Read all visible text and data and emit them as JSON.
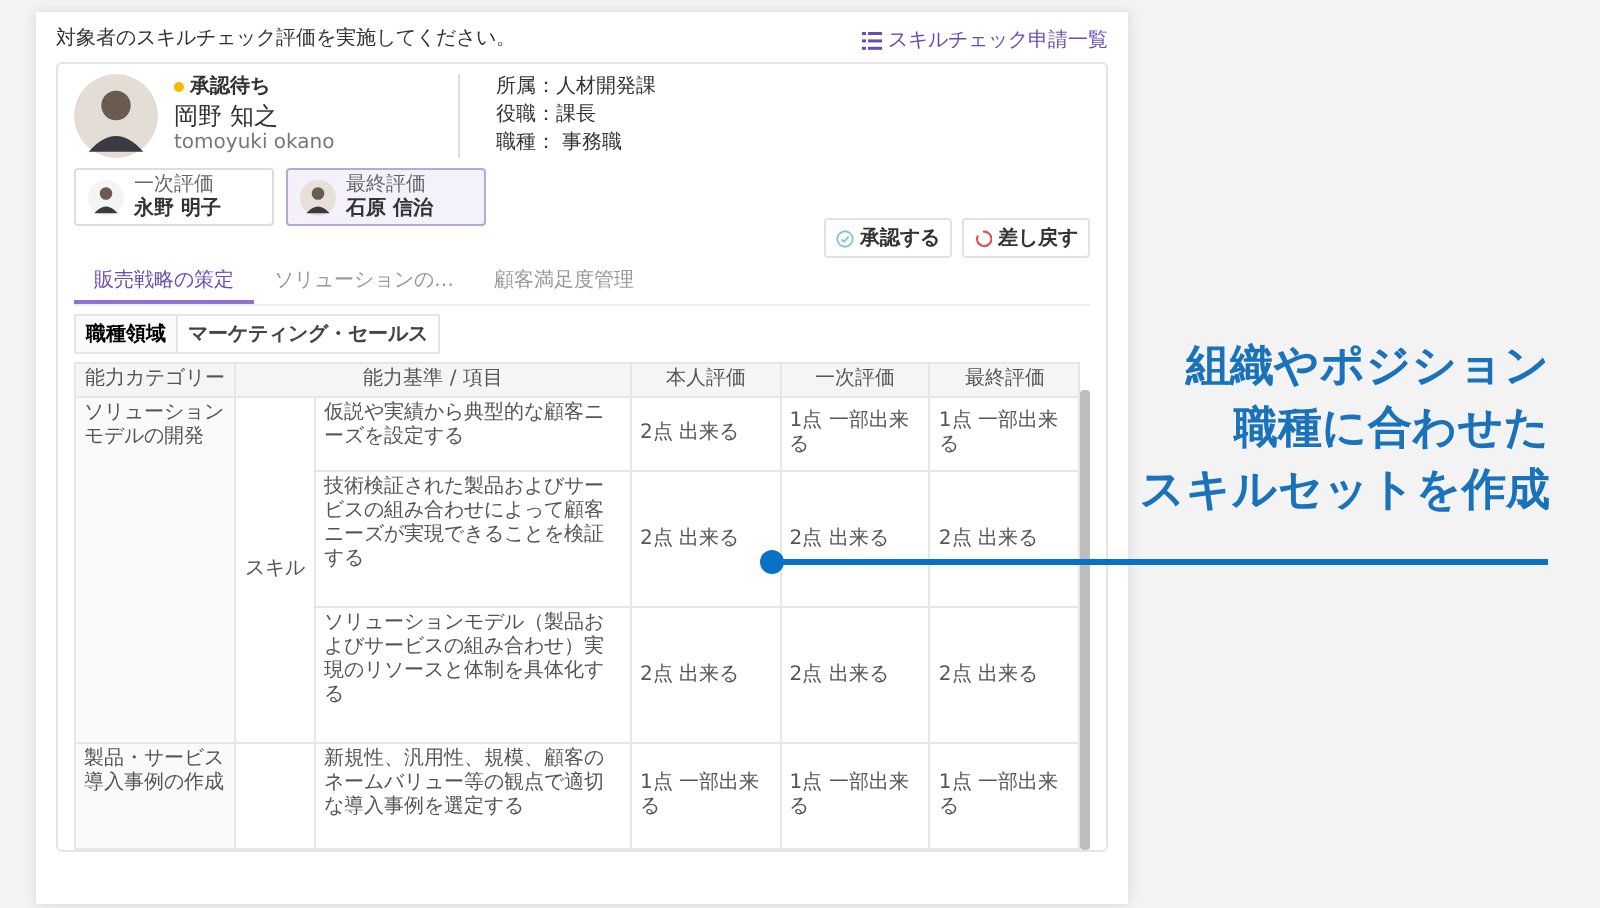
{
  "instruction": "対象者のスキルチェック評価を実施してください。",
  "list_link": {
    "label": "スキルチェック申請一覧"
  },
  "profile": {
    "status": "承認待ち",
    "name": "岡野 知之",
    "romaji": "tomoyuki okano",
    "details": [
      "所属：人材開発課",
      "役職：課長",
      "職種： 事務職"
    ]
  },
  "evaluators": [
    {
      "role": "一次評価",
      "name": "永野 明子",
      "selected": false
    },
    {
      "role": "最終評価",
      "name": "石原 信治",
      "selected": true
    }
  ],
  "actions": [
    {
      "label": "承認する",
      "kind": "approve"
    },
    {
      "label": "差し戻す",
      "kind": "return"
    }
  ],
  "tabs": [
    {
      "label": "販売戦略の策定",
      "selected": true
    },
    {
      "label": "ソリューションの…",
      "selected": false
    },
    {
      "label": "顧客満足度管理",
      "selected": false
    }
  ],
  "field": {
    "label": "職種領域",
    "value": "マーケティング・セールス"
  },
  "table": {
    "columns": [
      "能力カテゴリー",
      "能力基準 / 項目",
      "本人評価",
      "一次評価",
      "最終評価"
    ],
    "groups": [
      {
        "category": "ソリューションモデルの開発",
        "type": "スキル",
        "rows": [
          {
            "item": "仮説や実績から典型的な顧客ニーズを設定する",
            "self": "2点 出来る",
            "first": "1点 一部出来る",
            "final": "1点 一部出来る"
          },
          {
            "item": "技術検証された製品およびサービスの組み合わせによって顧客ニーズが実現できることを検証する",
            "self": "2点 出来る",
            "first": "2点 出来る",
            "final": "2点 出来る"
          },
          {
            "item": "ソリューションモデル（製品およびサービスの組み合わせ）実現のリソースと体制を具体化する",
            "self": "2点 出来る",
            "first": "2点 出来る",
            "final": "2点 出来る"
          }
        ]
      },
      {
        "category": "製品・サービス導入事例の作成",
        "rows": [
          {
            "item": "新規性、汎用性、規模、顧客のネームバリュー等の観点で適切な導入事例を選定する",
            "self": "1点 一部出来る",
            "first": "1点 一部出来る",
            "final": "1点 一部出来る"
          }
        ]
      }
    ]
  },
  "callout": [
    "組織やポジション",
    "職種に合わせた",
    "スキルセットを作成"
  ]
}
